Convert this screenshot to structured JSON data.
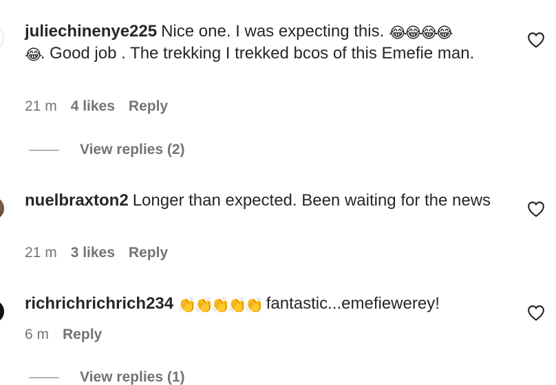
{
  "comments": [
    {
      "username": "juliechinenye225",
      "text_part1": "Nice one. I was expecting this.",
      "emoji_after_part1": "😂😂😂😂",
      "emoji_before_part2": "😂",
      "text_part2": ". Good job . The trekking I trekked bcos of this Emefie man.",
      "time": "21 m",
      "likes": "4 likes",
      "reply_label": "Reply",
      "view_replies": "View replies (2)",
      "avatar_icon": "avatar-outline"
    },
    {
      "username": "nuelbraxton2",
      "text_part1": "Longer than expected. Been waiting for the news",
      "time": "21 m",
      "likes": "3 likes",
      "reply_label": "Reply",
      "avatar_icon": "avatar-photo"
    },
    {
      "username": "richrichrichrich234",
      "emoji": "👏👏👏👏👏",
      "text_part1": "fantastic...emefiewerey!",
      "time": "6 m",
      "reply_label": "Reply",
      "view_replies": "View replies (1)",
      "avatar_icon": "avatar-dark"
    }
  ],
  "colors": {
    "text": "#262626",
    "secondary": "#737373",
    "background": "#ffffff"
  },
  "icons": {
    "like": "heart-outline-icon"
  }
}
